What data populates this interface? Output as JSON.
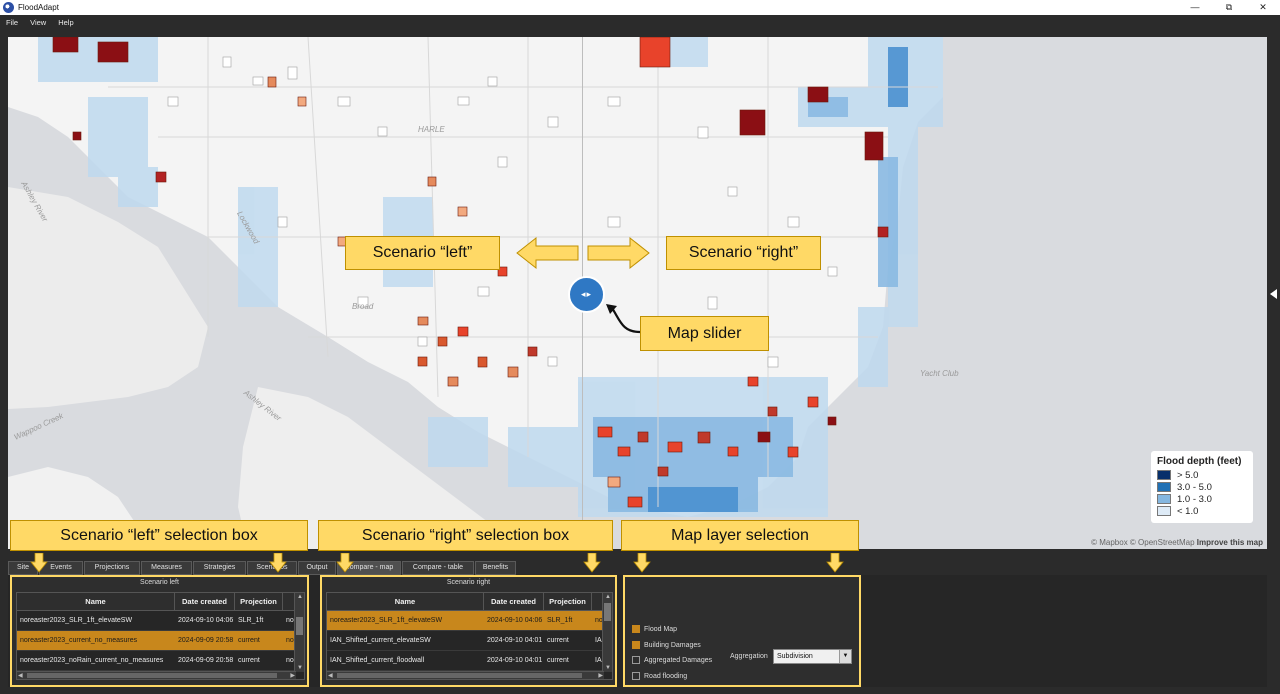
{
  "window": {
    "title": "FloodAdapt",
    "minimize": "—",
    "restore": "⧉",
    "close": "✕"
  },
  "menu": [
    "File",
    "View",
    "Help"
  ],
  "map": {
    "place_labels": [
      "HARLE",
      "Ashley River",
      "Lockwood",
      "Broad",
      "Ashley River",
      "Wappoo Creek",
      "Yacht Club"
    ],
    "attribution": {
      "mapbox": "© Mapbox",
      "osm": "© OpenStreetMap",
      "improve": "Improve this map"
    },
    "slider_glyph": "◂▸",
    "legend": {
      "title": "Flood depth (feet)",
      "items": [
        {
          "label": "> 5.0",
          "color": "#08306b"
        },
        {
          "label": "3.0 - 5.0",
          "color": "#2171b5"
        },
        {
          "label": "1.0 - 3.0",
          "color": "#85b7e0"
        },
        {
          "label": "< 1.0",
          "color": "#deebf7"
        }
      ]
    }
  },
  "callouts": {
    "scenario_left": "Scenario “left”",
    "scenario_right": "Scenario “right”",
    "map_slider": "Map slider",
    "left_box": "Scenario “left” selection box",
    "right_box": "Scenario “right” selection box",
    "layer_selection": "Map layer selection"
  },
  "tabs": [
    "Site",
    "Events",
    "Projections",
    "Measures",
    "Strategies",
    "Scenarios",
    "Output",
    "Compare - map",
    "Compare - table",
    "Benefits"
  ],
  "active_tab": "Compare - map",
  "scenario_left": {
    "title": "Scenario left",
    "columns": [
      "Name",
      "Date created",
      "Projection",
      ""
    ],
    "rows": [
      {
        "name": "noreaster2023_SLR_1ft_elevateSW",
        "date": "2024-09-10 04:06",
        "projection": "SLR_1ft",
        "extra": "nor"
      },
      {
        "name": "noreaster2023_current_no_measures",
        "date": "2024-09-09 20:58",
        "projection": "current",
        "extra": "nor",
        "selected": true
      },
      {
        "name": "noreaster2023_noRain_current_no_measures",
        "date": "2024-09-09 20:58",
        "projection": "current",
        "extra": "nor"
      }
    ]
  },
  "scenario_right": {
    "title": "Scenario right",
    "columns": [
      "Name",
      "Date created",
      "Projection",
      ""
    ],
    "rows": [
      {
        "name": "noreaster2023_SLR_1ft_elevateSW",
        "date": "2024-09-10 04:06",
        "projection": "SLR_1ft",
        "extra": "nor",
        "selected": true
      },
      {
        "name": "IAN_Shifted_current_elevateSW",
        "date": "2024-09-10 04:01",
        "projection": "current",
        "extra": "IAN"
      },
      {
        "name": "IAN_Shifted_current_floodwall",
        "date": "2024-09-10 04:01",
        "projection": "current",
        "extra": "IAN"
      }
    ]
  },
  "layers": {
    "items": [
      {
        "label": "Flood Map",
        "checked": true
      },
      {
        "label": "Building Damages",
        "checked": true
      },
      {
        "label": "Aggregated Damages",
        "checked": false
      },
      {
        "label": "Road flooding",
        "checked": false
      }
    ],
    "aggregation_label": "Aggregation",
    "aggregation_value": "Subdivision"
  },
  "colors": {
    "accent": "#ffd966",
    "selected_row": "#c8871c",
    "water": "#d9dbdf",
    "slider": "#2f78c4"
  }
}
